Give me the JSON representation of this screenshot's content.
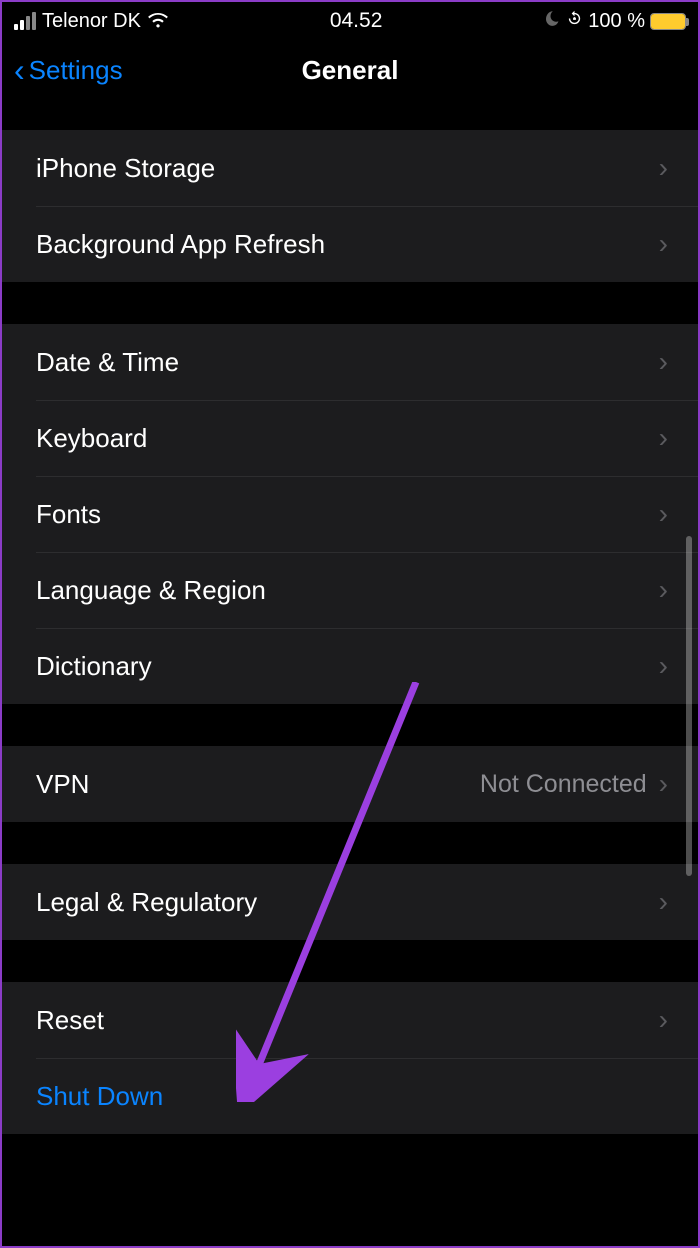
{
  "status_bar": {
    "carrier": "Telenor DK",
    "time": "04.52",
    "battery_percent": "100 %"
  },
  "nav": {
    "back_label": "Settings",
    "title": "General"
  },
  "groups": [
    {
      "rows": [
        {
          "label": "iPhone Storage",
          "detail": "",
          "link": false
        },
        {
          "label": "Background App Refresh",
          "detail": "",
          "link": false
        }
      ]
    },
    {
      "rows": [
        {
          "label": "Date & Time",
          "detail": "",
          "link": false
        },
        {
          "label": "Keyboard",
          "detail": "",
          "link": false
        },
        {
          "label": "Fonts",
          "detail": "",
          "link": false
        },
        {
          "label": "Language & Region",
          "detail": "",
          "link": false
        },
        {
          "label": "Dictionary",
          "detail": "",
          "link": false
        }
      ]
    },
    {
      "rows": [
        {
          "label": "VPN",
          "detail": "Not Connected",
          "link": false
        }
      ]
    },
    {
      "rows": [
        {
          "label": "Legal & Regulatory",
          "detail": "",
          "link": false
        }
      ]
    },
    {
      "rows": [
        {
          "label": "Reset",
          "detail": "",
          "link": false
        },
        {
          "label": "Shut Down",
          "detail": "",
          "link": true,
          "no_chevron": true
        }
      ]
    }
  ],
  "colors": {
    "accent": "#0a84ff",
    "annotation": "#9b3fe0",
    "battery": "#fecb2e"
  }
}
